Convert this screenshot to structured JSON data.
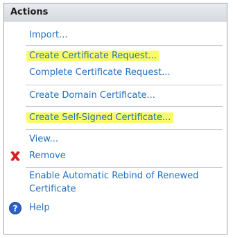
{
  "panel": {
    "title": "Actions",
    "items": {
      "import": "Import...",
      "create_request": "Create Certificate Request...",
      "complete_request": "Complete Certificate Request...",
      "create_domain": "Create Domain Certificate...",
      "create_self_signed": "Create Self-Signed Certificate...",
      "view": "View...",
      "remove": "Remove",
      "enable_rebind": "Enable Automatic Rebind of Renewed Certificate",
      "help": "Help"
    },
    "icons": {
      "remove": "red-x-icon",
      "help": "help-icon"
    },
    "colors": {
      "link": "#1f6fc1",
      "highlight": "#fbfb6a",
      "remove_icon": "#d42020",
      "help_icon": "#2a62c9"
    }
  }
}
